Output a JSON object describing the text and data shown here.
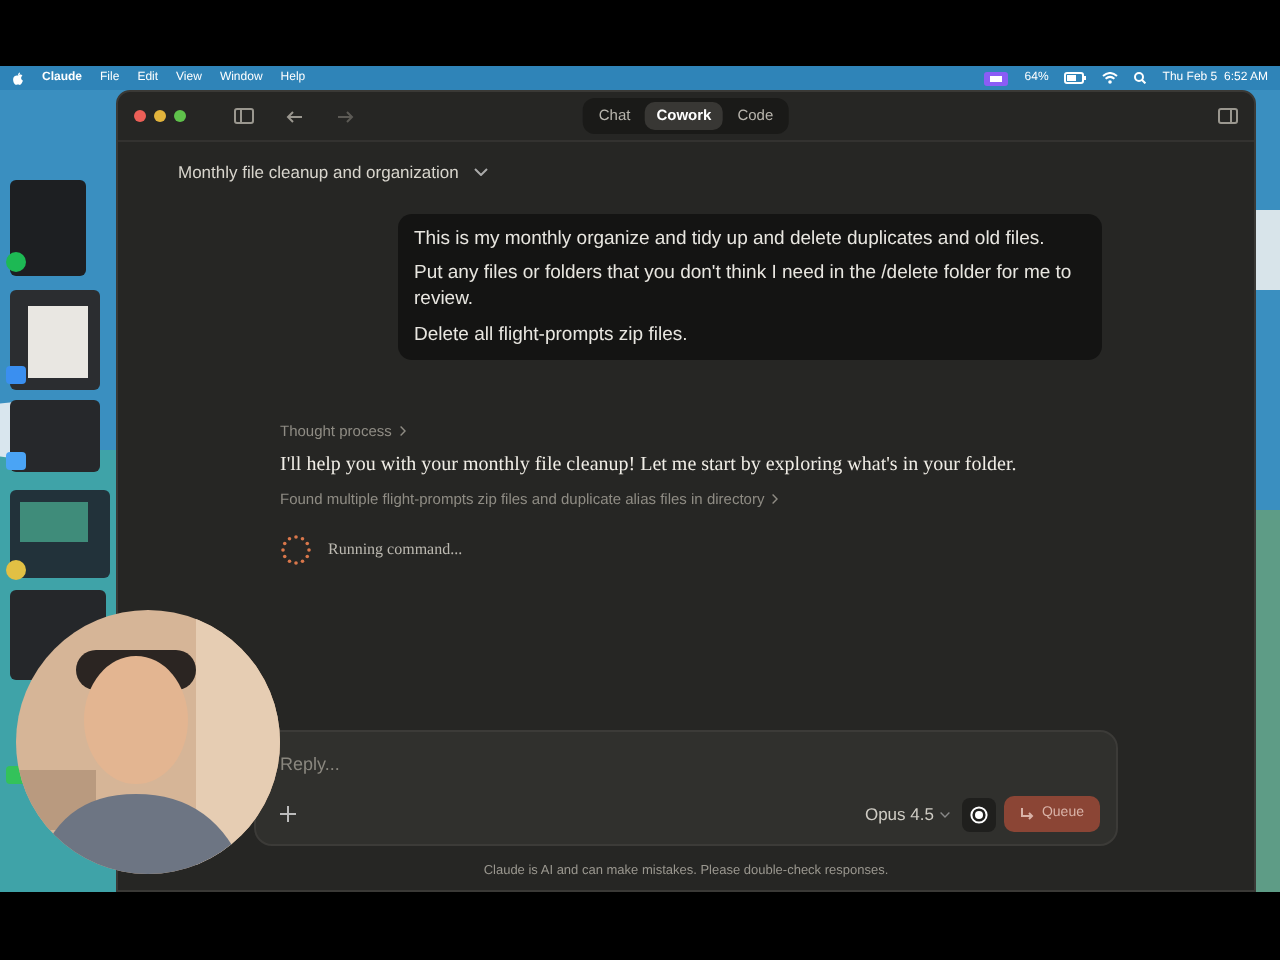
{
  "menu_bar": {
    "app": "Claude",
    "menus": [
      "File",
      "Edit",
      "View",
      "Window",
      "Help"
    ],
    "battery": "64%",
    "clock": "Thu Feb 5  6:52 AM"
  },
  "window": {
    "tabs": [
      {
        "label": "Chat",
        "selected": false
      },
      {
        "label": "Cowork",
        "selected": true
      },
      {
        "label": "Code",
        "selected": false
      }
    ],
    "title": "Monthly file cleanup and organization"
  },
  "messages": [
    {
      "kind": "user",
      "paragraphs": [
        "This is my monthly organize and tidy up and delete duplicates and old files.",
        "Put any files or folders that you don't think I need in the /delete folder for me to review.",
        "Delete all flight-prompts zip files."
      ]
    },
    {
      "kind": "disclosure",
      "text": "Thought process"
    },
    {
      "kind": "reply",
      "text": "I'll help you with your monthly file cleanup! Let me start by exploring what's in your folder."
    },
    {
      "kind": "disclosure",
      "text": "Found multiple flight-prompts zip files and duplicate alias files in directory"
    },
    {
      "kind": "status",
      "text": "Running command..."
    }
  ],
  "composer": {
    "placeholder": "Reply...",
    "model": "Opus 4.5",
    "send_label": "Queue"
  },
  "disclaimer": "Claude is AI and can make mistakes. Please double-check responses."
}
